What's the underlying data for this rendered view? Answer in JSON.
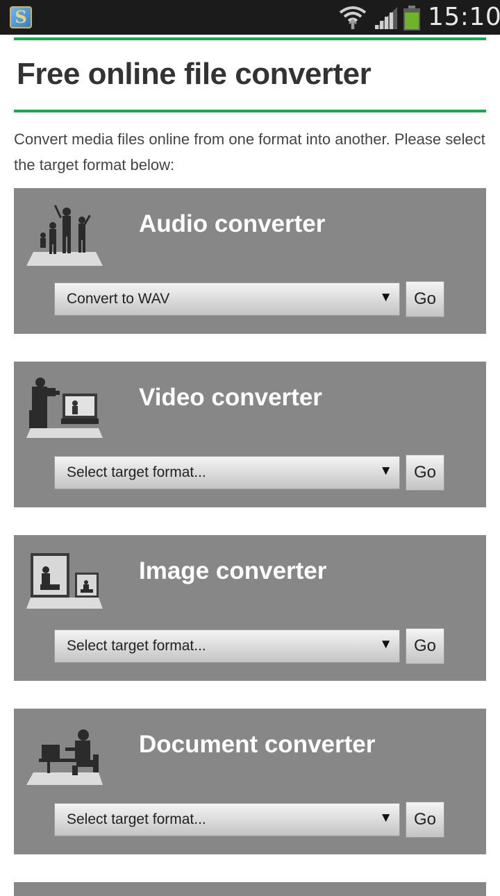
{
  "status_bar": {
    "time": "15:10",
    "app_icon_letter": "S",
    "icons": [
      "wifi-icon",
      "signal-icon",
      "battery-icon"
    ]
  },
  "page": {
    "title": "Free online file converter",
    "intro": "Convert media files online from one format into another. Please select the target format below:"
  },
  "colors": {
    "accent_green": "#17a94a",
    "card_gray": "#878787"
  },
  "converters": [
    {
      "title": "Audio converter",
      "selected": "Convert to WAV",
      "go": "Go",
      "icon": "dancers-icon"
    },
    {
      "title": "Video converter",
      "selected": "Select target format...",
      "go": "Go",
      "icon": "cameraman-icon"
    },
    {
      "title": "Image converter",
      "selected": "Select target format...",
      "go": "Go",
      "icon": "picture-frame-icon"
    },
    {
      "title": "Document converter",
      "selected": "Select target format...",
      "go": "Go",
      "icon": "desk-worker-icon"
    }
  ]
}
